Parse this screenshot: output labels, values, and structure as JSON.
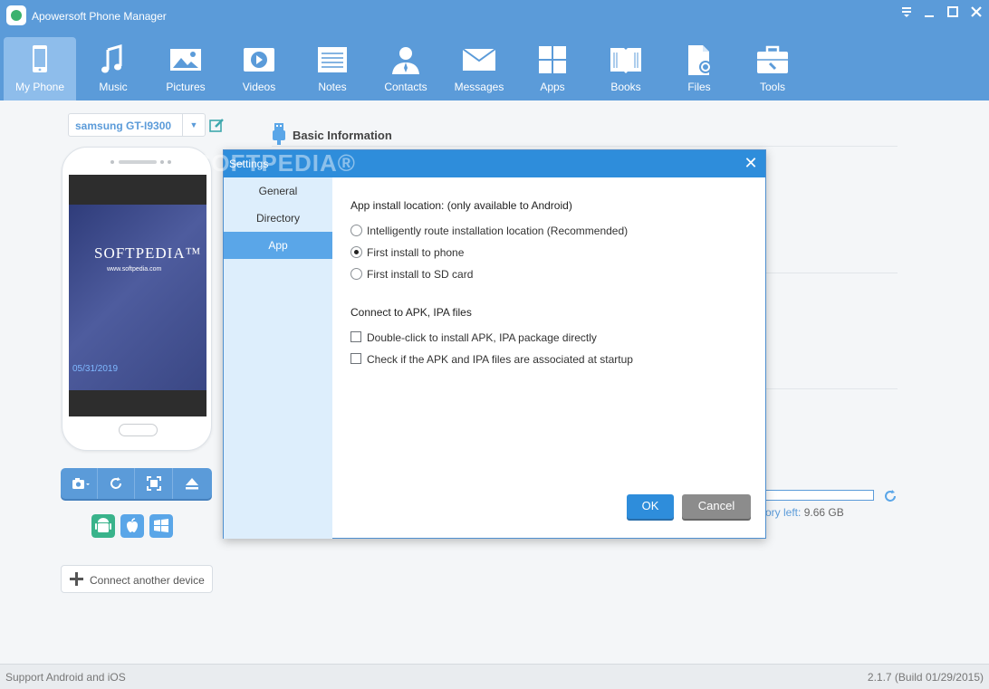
{
  "app": {
    "title": "Apowersoft Phone Manager"
  },
  "nav": [
    {
      "label": "My Phone",
      "icon": "phone-icon",
      "active": true
    },
    {
      "label": "Music",
      "icon": "music-icon"
    },
    {
      "label": "Pictures",
      "icon": "pictures-icon"
    },
    {
      "label": "Videos",
      "icon": "videos-icon"
    },
    {
      "label": "Notes",
      "icon": "notes-icon"
    },
    {
      "label": "Contacts",
      "icon": "contacts-icon"
    },
    {
      "label": "Messages",
      "icon": "messages-icon"
    },
    {
      "label": "Apps",
      "icon": "apps-icon"
    },
    {
      "label": "Books",
      "icon": "books-icon"
    },
    {
      "label": "Files",
      "icon": "files-icon"
    },
    {
      "label": "Tools",
      "icon": "tools-icon"
    }
  ],
  "device": {
    "name": "samsung GT-I9300",
    "screen_brand": "SOFTPEDIA™",
    "screen_url": "www.softpedia.com",
    "screen_date": "05/31/2019"
  },
  "connect_label": "Connect another device",
  "basic_info_title": "Basic Information",
  "storage": {
    "label": "Memory left:",
    "label_visible": "ory left:",
    "value": "9.66 GB"
  },
  "watermark": "SOFTPEDIA®",
  "dialog": {
    "title": "Settings",
    "sidebar": [
      "General",
      "Directory",
      "App"
    ],
    "active_tab": "App",
    "install_title": "App install location: (only available to Android)",
    "install_options": [
      {
        "label": "Intelligently route installation location (Recommended)",
        "selected": false
      },
      {
        "label": "First install to phone",
        "selected": true
      },
      {
        "label": "First install to SD card",
        "selected": false
      }
    ],
    "connect_title": "Connect to APK, IPA files",
    "file_options": [
      {
        "label": "Double-click to install APK, IPA package directly",
        "checked": false
      },
      {
        "label": "Check if the APK and IPA files are associated at startup",
        "checked": false
      }
    ],
    "ok_label": "OK",
    "cancel_label": "Cancel"
  },
  "status": {
    "left": "Support Android and iOS",
    "right": "2.1.7 (Build 01/29/2015)"
  },
  "colors": {
    "header": "#5b9bd9",
    "accent": "#2e8ddb",
    "sidebar": "#ddeefc"
  }
}
